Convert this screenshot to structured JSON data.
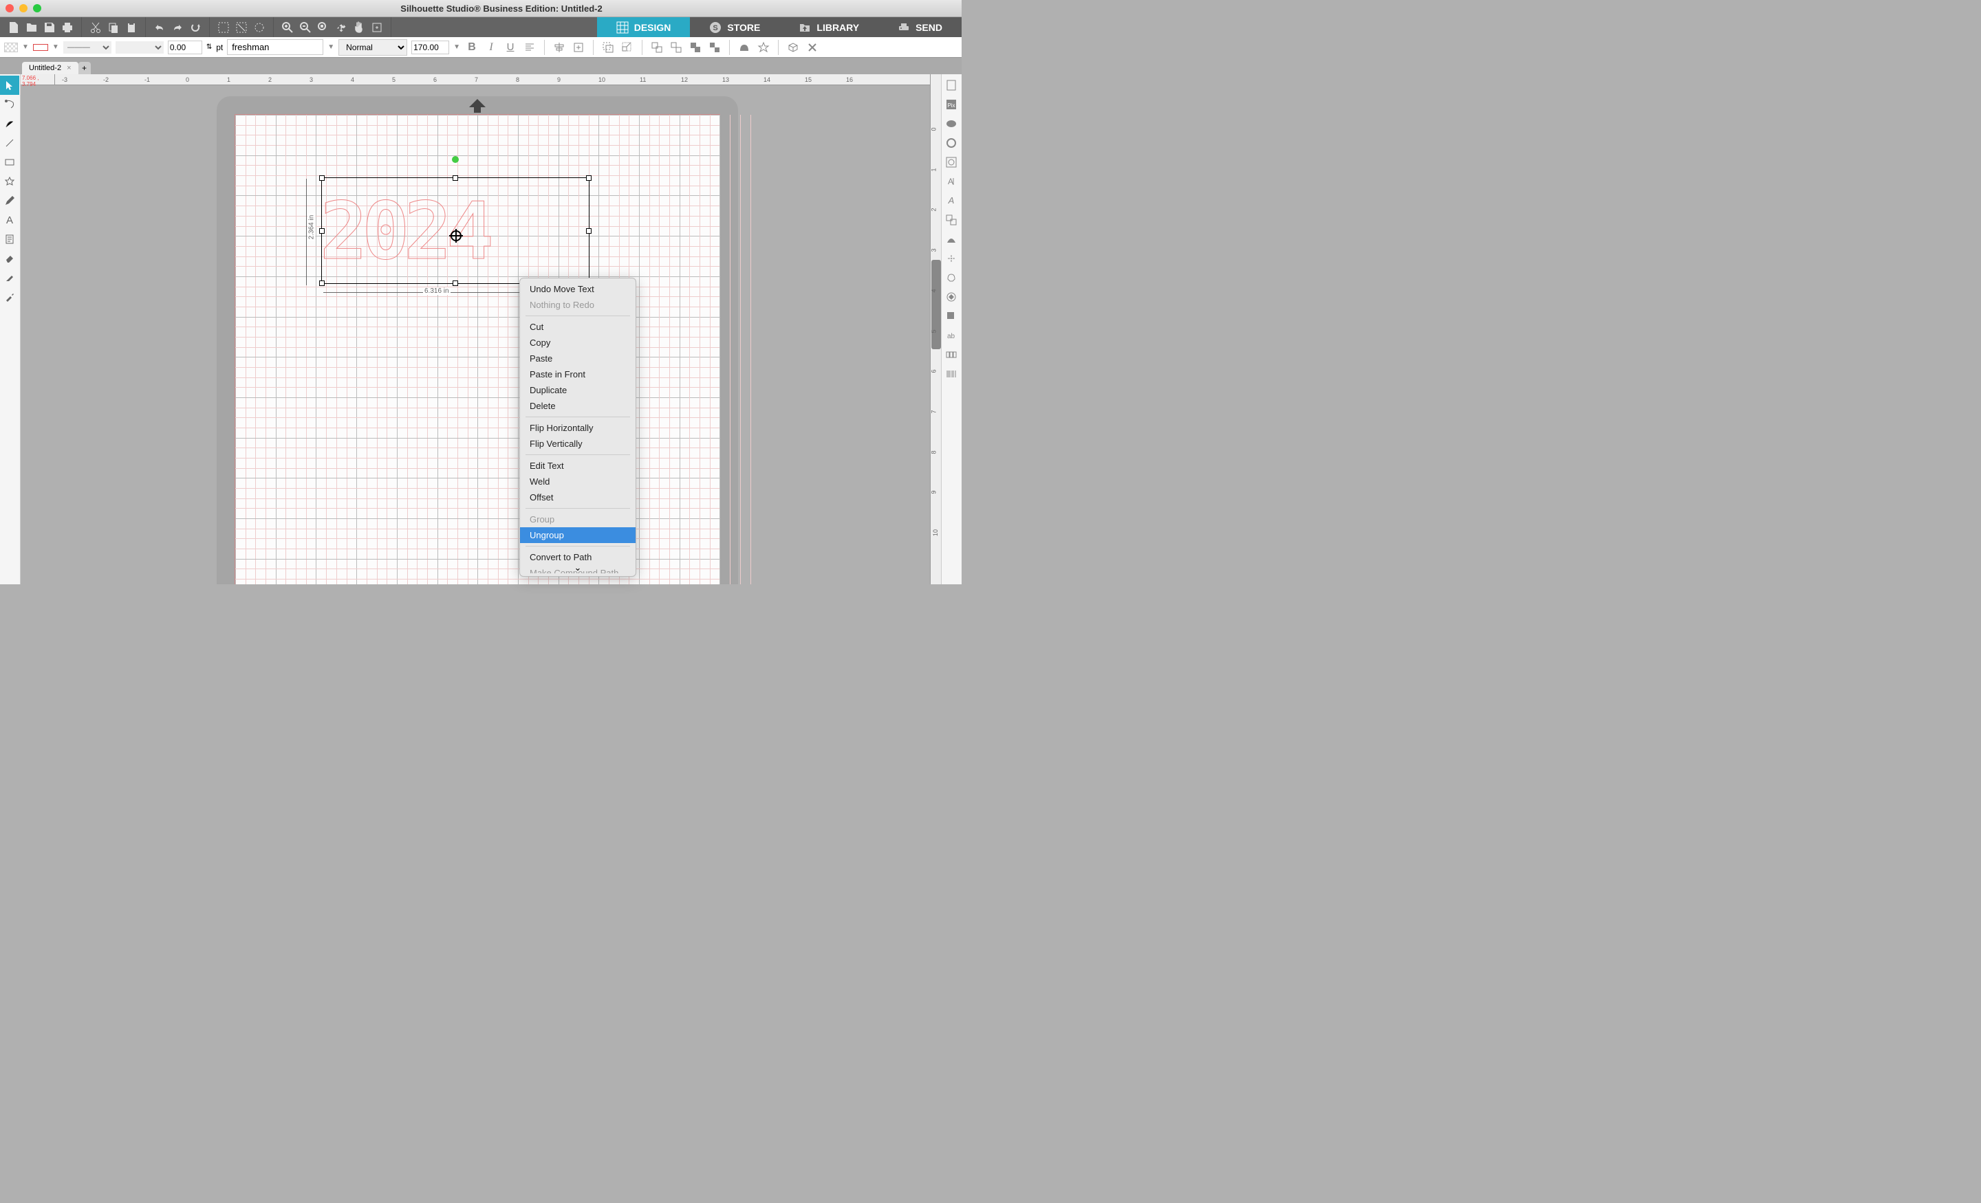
{
  "title": "Silhouette Studio® Business Edition: Untitled-2",
  "mainTabs": [
    {
      "label": "DESIGN",
      "icon": "grid"
    },
    {
      "label": "STORE",
      "icon": "s"
    },
    {
      "label": "LIBRARY",
      "icon": "folder"
    },
    {
      "label": "SEND",
      "icon": "printer"
    }
  ],
  "toolbar2": {
    "lineWeight": "0.00",
    "unit": "pt",
    "font": "freshman",
    "style": "Normal",
    "size": "170.00"
  },
  "docTab": "Untitled-2",
  "coords": "7.066 , 3.794",
  "ruler": [
    "-3",
    "-2",
    "-1",
    "0",
    "1",
    "2",
    "3",
    "4",
    "5",
    "6",
    "7",
    "8",
    "9",
    "10",
    "11",
    "12",
    "13",
    "14",
    "15",
    "16"
  ],
  "rulerV": [
    "0",
    "1",
    "2",
    "3",
    "4",
    "5",
    "6",
    "7",
    "8",
    "9",
    "10"
  ],
  "canvasText": "2024",
  "dimensions": {
    "width": "6.316 in",
    "height": "2.364 in"
  },
  "contextMenu": {
    "items": [
      {
        "label": "Undo Move Text",
        "type": "item"
      },
      {
        "label": "Nothing to Redo",
        "type": "disabled"
      },
      {
        "type": "sep"
      },
      {
        "label": "Cut",
        "type": "item"
      },
      {
        "label": "Copy",
        "type": "item"
      },
      {
        "label": "Paste",
        "type": "item"
      },
      {
        "label": "Paste in Front",
        "type": "item"
      },
      {
        "label": "Duplicate",
        "type": "item"
      },
      {
        "label": "Delete",
        "type": "item"
      },
      {
        "type": "sep"
      },
      {
        "label": "Flip Horizontally",
        "type": "item"
      },
      {
        "label": "Flip Vertically",
        "type": "item"
      },
      {
        "type": "sep"
      },
      {
        "label": "Edit Text",
        "type": "item"
      },
      {
        "label": "Weld",
        "type": "item"
      },
      {
        "label": "Offset",
        "type": "item"
      },
      {
        "type": "sep"
      },
      {
        "label": "Group",
        "type": "disabled"
      },
      {
        "label": "Ungroup",
        "type": "highlighted"
      },
      {
        "type": "sep"
      },
      {
        "label": "Convert to Path",
        "type": "item"
      },
      {
        "label": "Make Compound Path",
        "type": "disabled-partial"
      }
    ]
  }
}
